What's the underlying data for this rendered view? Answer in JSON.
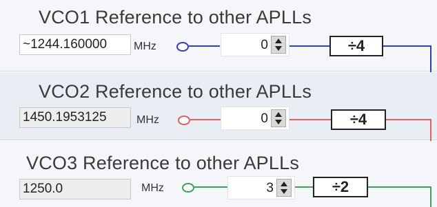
{
  "vco1": {
    "title": "VCO1 Reference to other APLLs",
    "frequency": "~1244.160000",
    "unit": "MHz",
    "spinner_value": "0",
    "divider": "÷4",
    "color": "#2c3ed0"
  },
  "vco2": {
    "title": "VCO2 Reference to other APLLs",
    "frequency": "1450.1953125",
    "unit": "MHz",
    "spinner_value": "0",
    "divider": "÷4",
    "color": "#e85c5c"
  },
  "vco3": {
    "title": "VCO3 Reference to other APLLs",
    "frequency": "1250.0",
    "unit": "MHz",
    "spinner_value": "3",
    "divider": "÷2",
    "color": "#3aa35a"
  },
  "icons": {
    "spinner": "up-down-arrows",
    "port": "hollow-circle"
  }
}
